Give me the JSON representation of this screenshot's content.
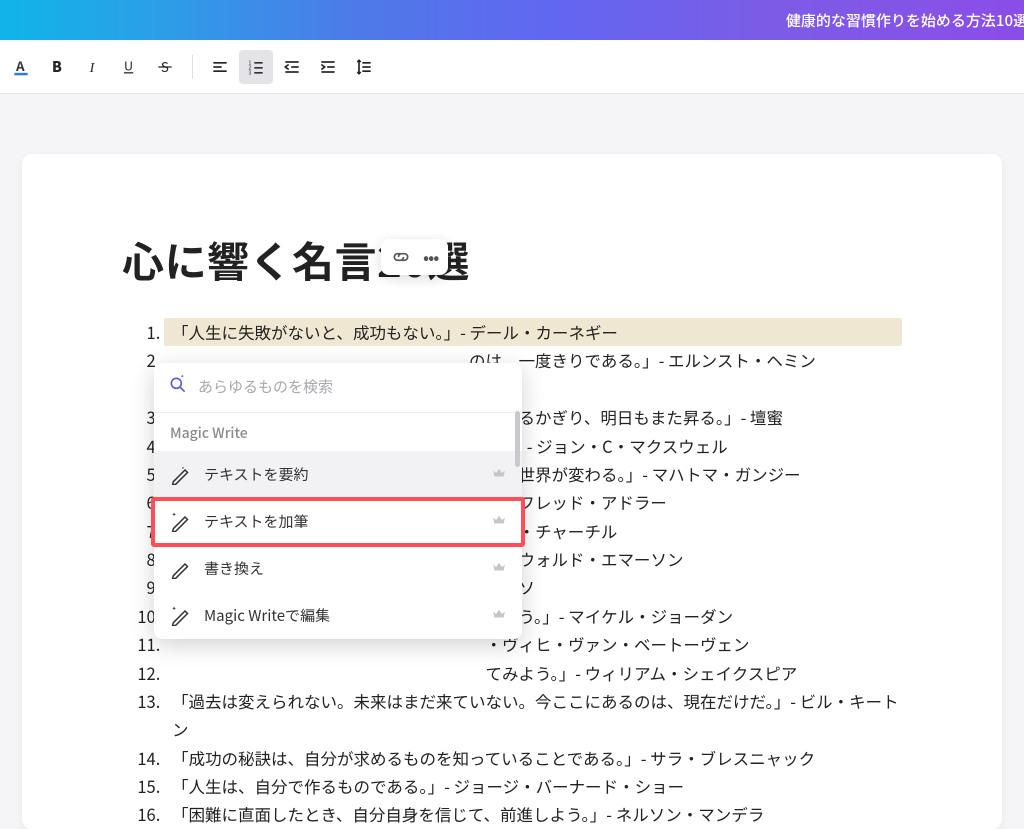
{
  "banner": {
    "text": "健康的な習慣作りを始める方法10選"
  },
  "toolbar": {
    "font_color": "A",
    "bold": "B",
    "italic": "I",
    "underline": "U",
    "strike": "S"
  },
  "doc": {
    "title": "心に響く名言20選",
    "quotes": [
      "「人生に失敗がないと、成功もない。」- デール・カーネギー",
      "  　　　　　　　　　　　　　　　　　　のは、一度きりである。」- エルンスト・ヘミン",
      "　　　　　　　　　　　　　　　　　　　求めるかぎり、明日もまた昇る。」- 壇蜜",
      "　　　　　　　　　　　　　　　　　　　る。」- ジョン・C・マクスウェル",
      "　　　　　　　　　　　　　　　　　　　ば、世界が変わる。」- マハトマ・ガンジー",
      "　　　　　　　　　　　　　　　　　　　アルフレッド・アドラー",
      "　　　　　　　　　　　　　　　　　　　トン・チャーチル",
      "　　　　　　　　　　　　　　　　　　　フ・ウォルド・エマーソン",
      "　　　　　　　　　　　　　　　　　　　ピカソ",
      "　　　　　　　　　　　　　　　　　　　めよう。」- マイケル・ジョーダン",
      "　　　　　　　　　　　　　　　　　　　・ヴィヒ・ヴァン・ベートーヴェン",
      "　　　　　　　　　　　　　　　　　　　てみよう。」- ウィリアム・シェイクスピア",
      "「過去は変えられない。未来はまだ来ていない。今ここにあるのは、現在だけだ。」- ビル・キートン",
      "「成功の秘訣は、自分が求めるものを知っていることである。」- サラ・ブレスニャック",
      "「人生は、自分で作るものである。」- ジョージ・バーナード・ショー",
      "「困難に直面したとき、自分自身を信じて、前進しよう。」- ネルソン・マンデラ"
    ]
  },
  "magic": {
    "search_placeholder": "あらゆるものを検索",
    "section": "Magic Write",
    "items": [
      "テキストを要約",
      "テキストを加筆",
      "書き換え",
      "Magic Writeで編集"
    ]
  }
}
